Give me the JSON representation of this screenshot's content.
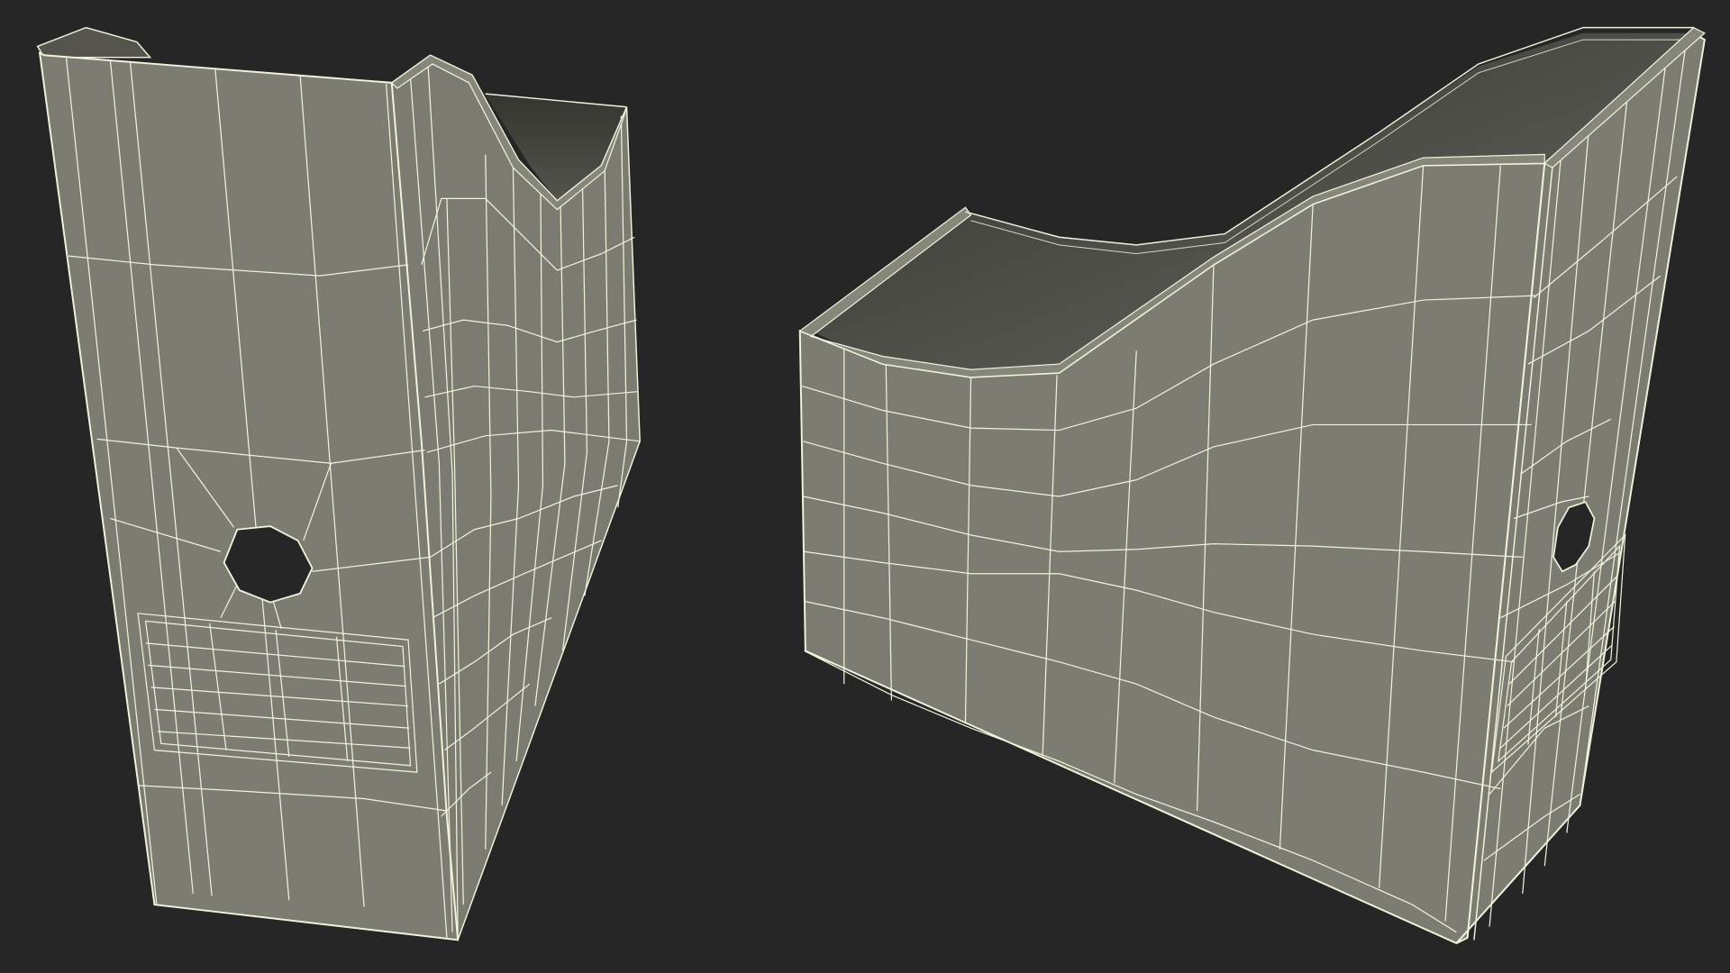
{
  "scene": {
    "description_visible_text": "",
    "background_color": "#262626",
    "model_fill_color": "#7c7c72",
    "model_dark_fill_color": "#6b6b62",
    "interior_color": "#3a3a36",
    "wireframe_color": "#f2f2dc",
    "render_style": "wireframe-overlay"
  },
  "objects": [
    {
      "id": "file-holder-front-view",
      "features": [
        "thumb-hole-octagon",
        "label-grid"
      ]
    },
    {
      "id": "file-holder-angled-view",
      "features": [
        "thumb-hole-octagon",
        "label-grid",
        "curved-cutout"
      ]
    }
  ]
}
